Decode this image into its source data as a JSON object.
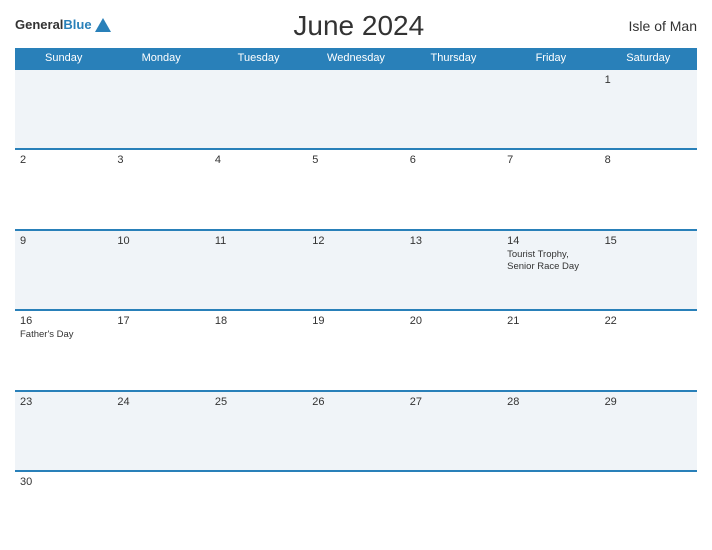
{
  "header": {
    "logo_line1": "General",
    "logo_line2": "Blue",
    "title": "June 2024",
    "region": "Isle of Man"
  },
  "calendar": {
    "days_of_week": [
      "Sunday",
      "Monday",
      "Tuesday",
      "Wednesday",
      "Thursday",
      "Friday",
      "Saturday"
    ],
    "weeks": [
      [
        {
          "day": "",
          "bg": "alt"
        },
        {
          "day": "",
          "bg": "alt"
        },
        {
          "day": "",
          "bg": "alt"
        },
        {
          "day": "",
          "bg": "alt"
        },
        {
          "day": "",
          "bg": "alt"
        },
        {
          "day": "",
          "bg": "alt"
        },
        {
          "day": "1",
          "bg": "alt",
          "event": ""
        }
      ],
      [
        {
          "day": "2",
          "bg": "white"
        },
        {
          "day": "3",
          "bg": "white"
        },
        {
          "day": "4",
          "bg": "white"
        },
        {
          "day": "5",
          "bg": "white"
        },
        {
          "day": "6",
          "bg": "white"
        },
        {
          "day": "7",
          "bg": "white"
        },
        {
          "day": "8",
          "bg": "white"
        }
      ],
      [
        {
          "day": "9",
          "bg": "alt"
        },
        {
          "day": "10",
          "bg": "alt"
        },
        {
          "day": "11",
          "bg": "alt"
        },
        {
          "day": "12",
          "bg": "alt"
        },
        {
          "day": "13",
          "bg": "alt"
        },
        {
          "day": "14",
          "bg": "alt",
          "event": "Tourist Trophy, Senior Race Day"
        },
        {
          "day": "15",
          "bg": "alt"
        }
      ],
      [
        {
          "day": "16",
          "bg": "white",
          "event": "Father's Day"
        },
        {
          "day": "17",
          "bg": "white"
        },
        {
          "day": "18",
          "bg": "white"
        },
        {
          "day": "19",
          "bg": "white"
        },
        {
          "day": "20",
          "bg": "white"
        },
        {
          "day": "21",
          "bg": "white"
        },
        {
          "day": "22",
          "bg": "white"
        }
      ],
      [
        {
          "day": "23",
          "bg": "alt"
        },
        {
          "day": "24",
          "bg": "alt"
        },
        {
          "day": "25",
          "bg": "alt"
        },
        {
          "day": "26",
          "bg": "alt"
        },
        {
          "day": "27",
          "bg": "alt"
        },
        {
          "day": "28",
          "bg": "alt"
        },
        {
          "day": "29",
          "bg": "alt"
        }
      ],
      [
        {
          "day": "30",
          "bg": "white"
        },
        {
          "day": "",
          "bg": "white"
        },
        {
          "day": "",
          "bg": "white"
        },
        {
          "day": "",
          "bg": "white"
        },
        {
          "day": "",
          "bg": "white"
        },
        {
          "day": "",
          "bg": "white"
        },
        {
          "day": "",
          "bg": "white"
        }
      ]
    ]
  }
}
